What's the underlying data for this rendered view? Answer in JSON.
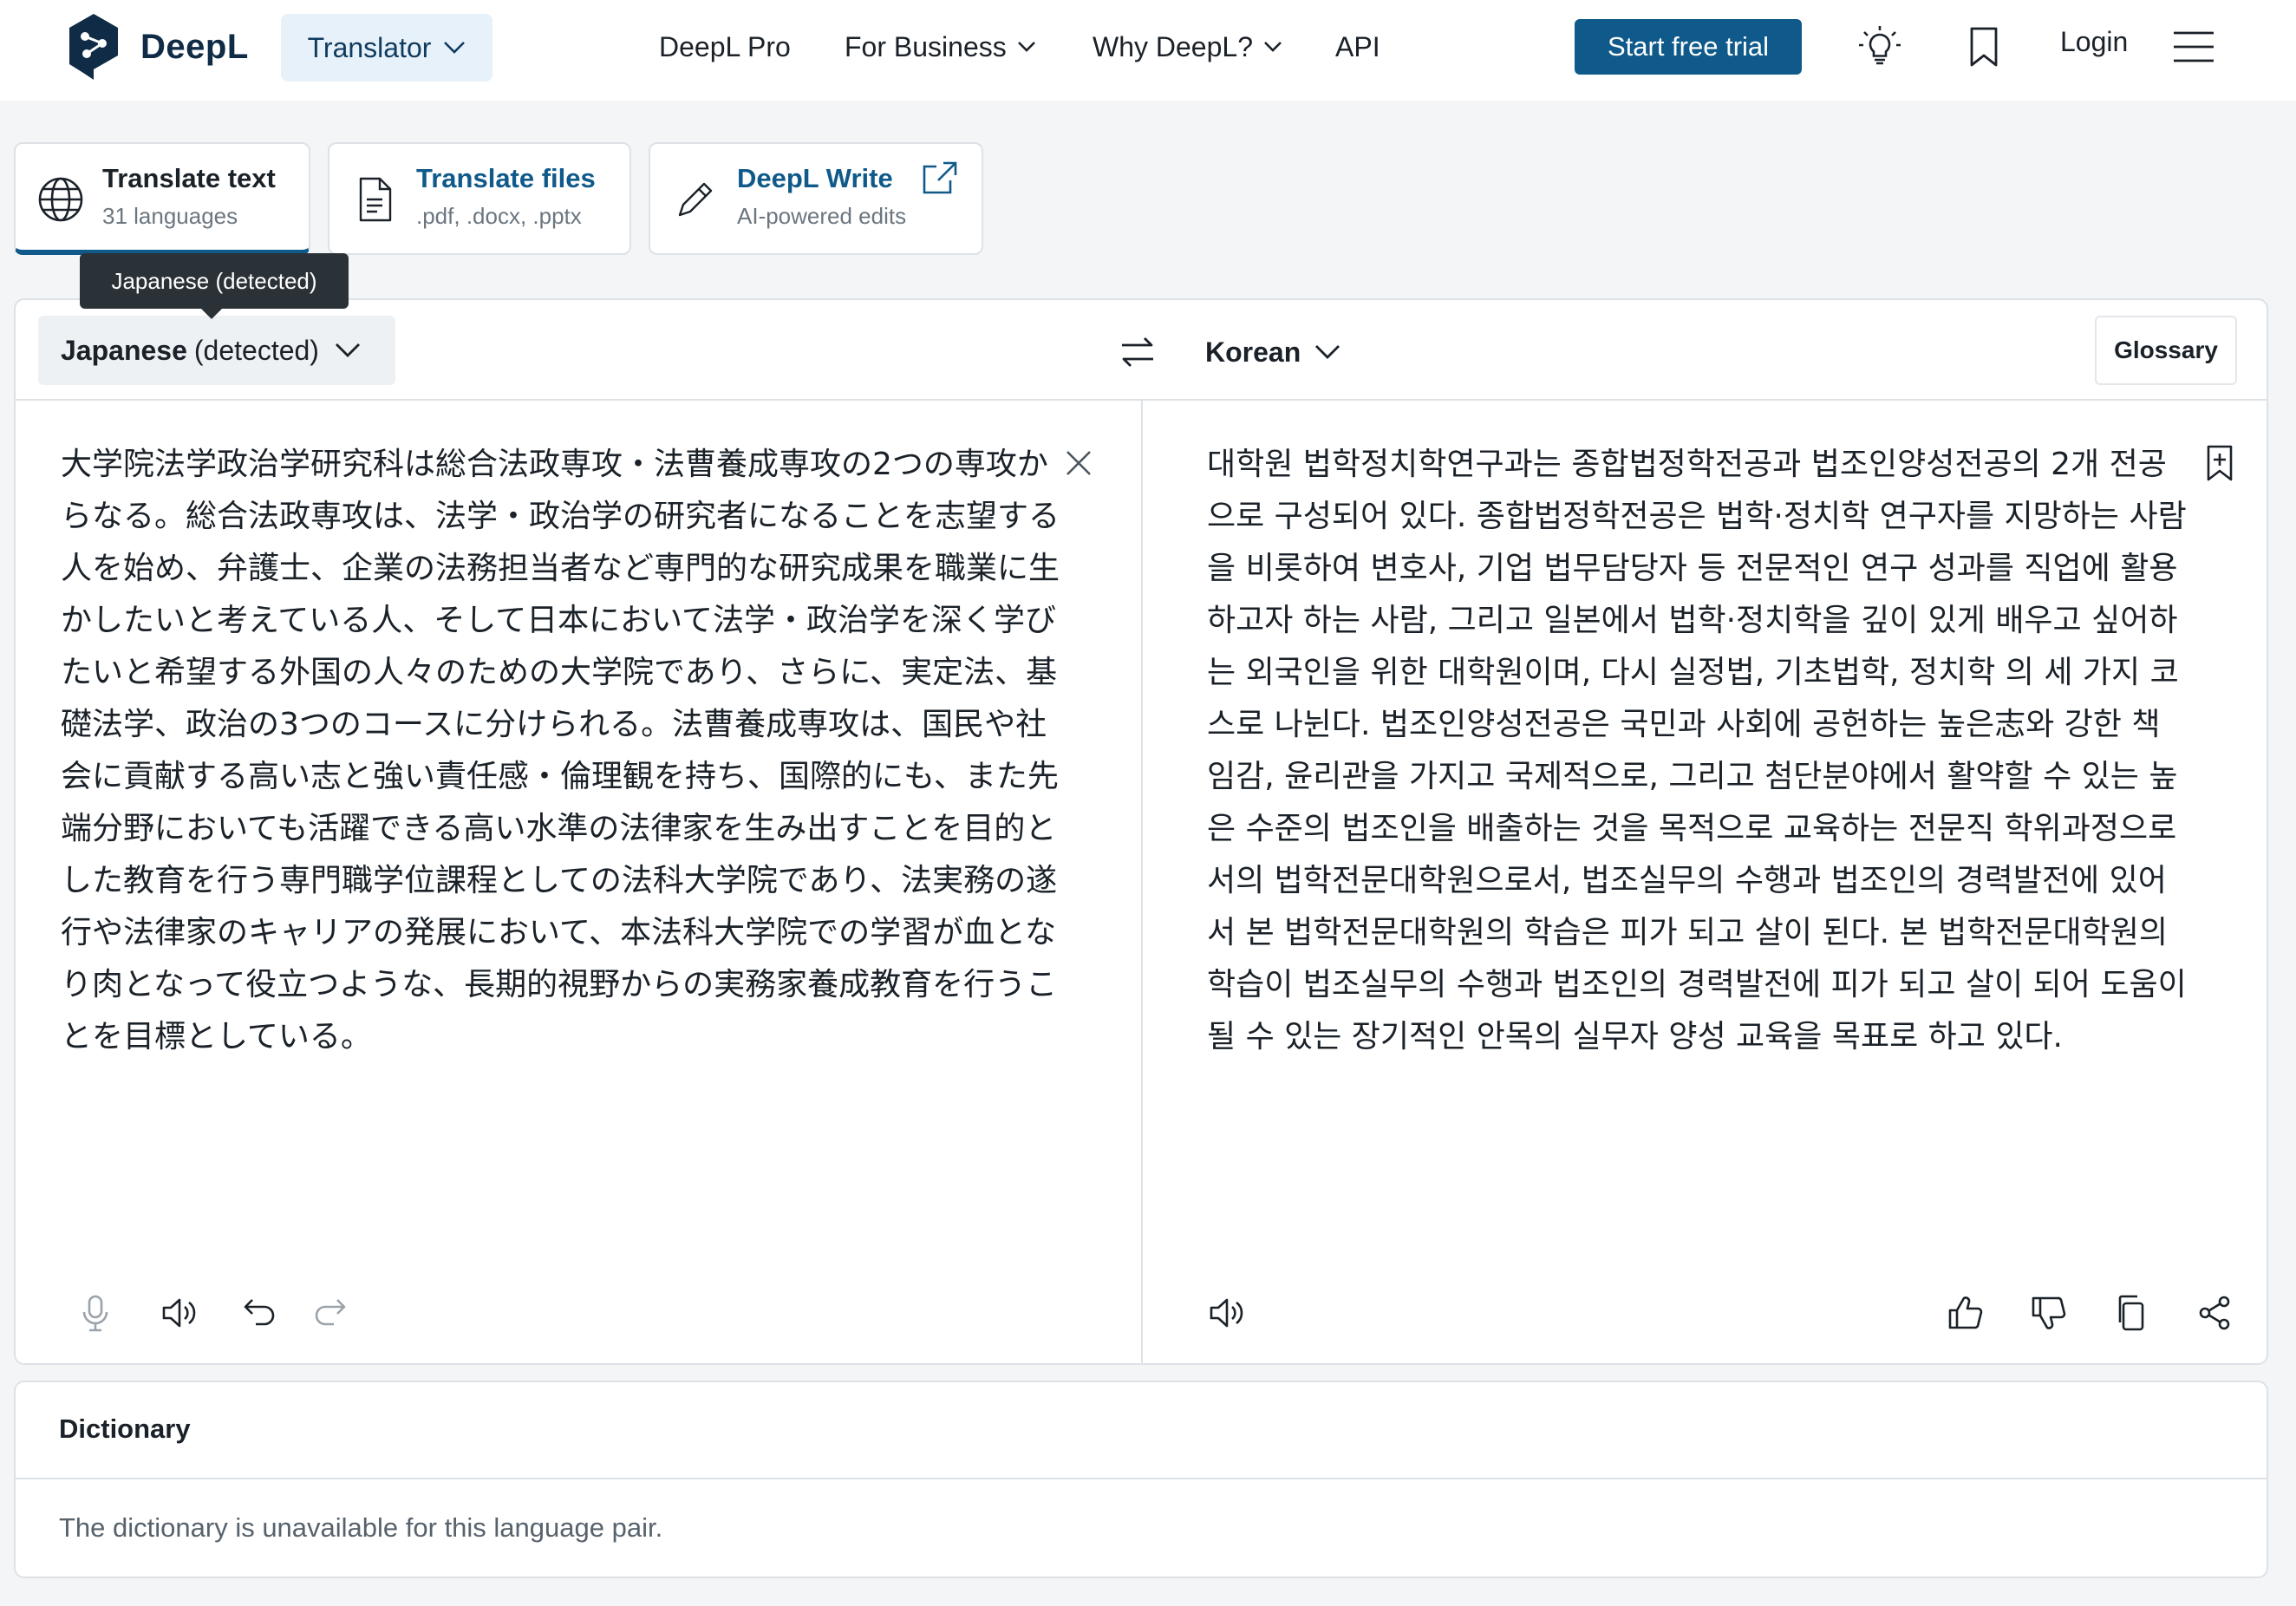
{
  "header": {
    "logo_text": "DeepL",
    "translator_label": "Translator",
    "nav": {
      "pro": "DeepL Pro",
      "business": "For Business",
      "why": "Why DeepL?",
      "api": "API"
    },
    "trial_label": "Start free trial",
    "login_label": "Login"
  },
  "tabs": [
    {
      "title": "Translate text",
      "subtitle": "31 languages"
    },
    {
      "title": "Translate files",
      "subtitle": ".pdf, .docx, .pptx"
    },
    {
      "title": "DeepL Write",
      "subtitle": "AI-powered edits"
    }
  ],
  "tooltip": "Japanese (detected)",
  "translator": {
    "source_lang": "Japanese",
    "source_detect": "(detected)",
    "target_lang": "Korean",
    "glossary_label": "Glossary",
    "source_text": "大学院法学政治学研究科は総合法政専攻・法曹養成専攻の2つの専攻からなる。総合法政専攻は、法学・政治学の研究者になることを志望する人を始め、弁護士、企業の法務担当者など専門的な研究成果を職業に生かしたいと考えている人、そして日本において法学・政治学を深く学びたいと希望する外国の人々のための大学院であり、さらに、実定法、基礎法学、政治の3つのコースに分けられる。法曹養成専攻は、国民や社会に貢献する高い志と強い責任感・倫理観を持ち、国際的にも、また先端分野においても活躍できる高い水準の法律家を生み出すことを目的とした教育を行う専門職学位課程としての法科大学院であり、法実務の遂行や法律家のキャリアの発展において、本法科大学院での学習が血となり肉となって役立つような、長期的視野からの実務家養成教育を行うことを目標としている。",
    "target_text": "대학원 법학정치학연구과는 종합법정학전공과 법조인양성전공의 2개 전공으로 구성되어 있다. 종합법정학전공은 법학·정치학 연구자를 지망하는 사람을 비롯하여 변호사, 기업 법무담당자 등 전문적인 연구 성과를 직업에 활용하고자 하는 사람, 그리고 일본에서 법학·정치학을 깊이 있게 배우고 싶어하는 외국인을 위한 대학원이며, 다시 실정법, 기초법학, 정치학 의 세 가지 코스로 나뉜다. 법조인양성전공은 국민과 사회에 공헌하는 높은志와 강한 책임감, 윤리관을 가지고 국제적으로, 그리고 첨단분야에서 활약할 수 있는 높은 수준의 법조인을 배출하는 것을 목적으로 교육하는 전문직 학위과정으로서의 법학전문대학원으로서, 법조실무의 수행과 법조인의 경력발전에 있어서 본 법학전문대학원의 학습은 피가 되고 살이 된다. 본 법학전문대학원의 학습이 법조실무의 수행과 법조인의 경력발전에 피가 되고 살이 되어 도움이 될 수 있는 장기적인 안목의 실무자 양성 교육을 목표로 하고 있다."
  },
  "dictionary": {
    "title": "Dictionary",
    "message": "The dictionary is unavailable for this language pair."
  },
  "icons": {
    "logo": "deepl-logo-icon",
    "theme": "lightbulb-icon",
    "saved": "bookmark-icon",
    "menu": "hamburger-menu-icon",
    "accent_color": "#0f5a8a"
  }
}
